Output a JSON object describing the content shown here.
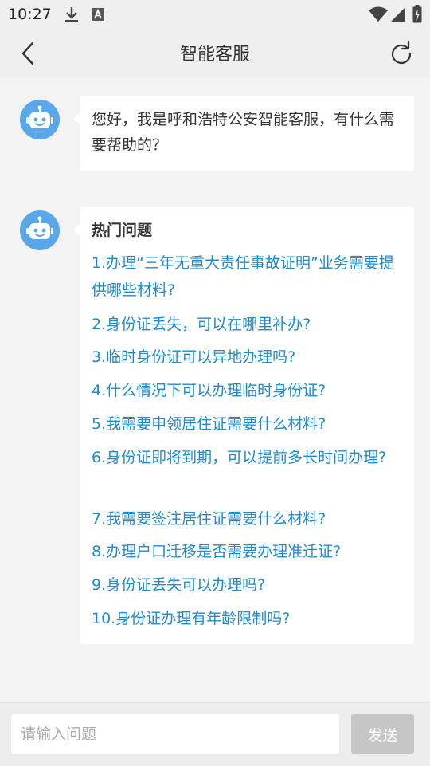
{
  "status_bar": {
    "time": "10:27",
    "icons": [
      "download-icon",
      "text-a-icon",
      "wifi-icon",
      "signal-icon",
      "battery-charging-icon"
    ]
  },
  "header": {
    "title": "智能客服",
    "back_icon": "chevron-left-icon",
    "refresh_icon": "refresh-icon"
  },
  "messages": {
    "greeting": "您好，我是呼和浩特公安智能客服，有什么需要帮助的？",
    "faq": {
      "title": "热门问题",
      "items": [
        "1.办理“三年无重大责任事故证明”业务需要提供哪些材料?",
        "2.身份证丢失，可以在哪里补办?",
        "3.临时身份证可以异地办理吗?",
        "4.什么情况下可以办理临时身份证?",
        "5.我需要申领居住证需要什么材料?",
        "6.身份证即将到期，可以提前多长时间办理?",
        "7.我需要签注居住证需要什么材料?",
        "8.办理户口迁移是否需要办理准迁证?",
        "9.身份证丢失可以办理吗?",
        "10.身份证办理有年龄限制吗?"
      ]
    }
  },
  "input_bar": {
    "placeholder": "请输入问题",
    "value": "",
    "send_label": "发送"
  },
  "colors": {
    "link": "#1d8bd1",
    "avatar": "#5aa8ea",
    "send_disabled": "#c6c6c6"
  }
}
